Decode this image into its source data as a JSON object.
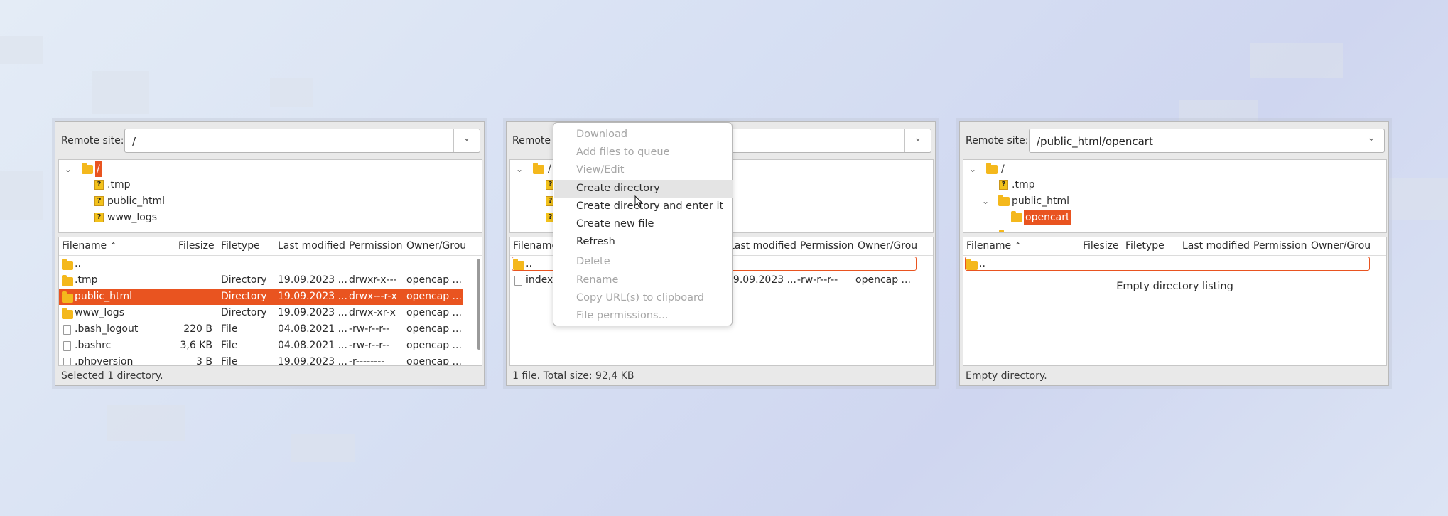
{
  "panel1": {
    "site_label": "Remote site:",
    "path": "/",
    "tree": [
      {
        "label": "/",
        "icon": "folder-icon"
      },
      {
        "label": ".tmp",
        "icon": "unknown-folder-icon"
      },
      {
        "label": "public_html",
        "icon": "unknown-folder-icon"
      },
      {
        "label": "www_logs",
        "icon": "unknown-folder-icon"
      }
    ],
    "columns": [
      "Filename",
      "Filesize",
      "Filetype",
      "Last modified",
      "Permission",
      "Owner/Grou"
    ],
    "rows": [
      {
        "name": "..",
        "size": "",
        "type": "",
        "modified": "",
        "perm": "",
        "owner": "",
        "kind": "folder"
      },
      {
        "name": ".tmp",
        "size": "",
        "type": "Directory",
        "modified": "19.09.2023 ...",
        "perm": "drwxr-x---",
        "owner": "opencap ...",
        "kind": "folder"
      },
      {
        "name": "public_html",
        "size": "",
        "type": "Directory",
        "modified": "19.09.2023 ...",
        "perm": "drwx---r-x",
        "owner": "opencap ...",
        "kind": "folder"
      },
      {
        "name": "www_logs",
        "size": "",
        "type": "Directory",
        "modified": "19.09.2023 ...",
        "perm": "drwx-xr-x",
        "owner": "opencap ...",
        "kind": "folder"
      },
      {
        "name": ".bash_logout",
        "size": "220 B",
        "type": "File",
        "modified": "04.08.2021 ...",
        "perm": "-rw-r--r--",
        "owner": "opencap ...",
        "kind": "file"
      },
      {
        "name": ".bashrc",
        "size": "3,6 KB",
        "type": "File",
        "modified": "04.08.2021 ...",
        "perm": "-rw-r--r--",
        "owner": "opencap ...",
        "kind": "file"
      },
      {
        "name": ".phpversion",
        "size": "3 B",
        "type": "File",
        "modified": "19.09.2023 ...",
        "perm": "-r--------",
        "owner": "opencap ...",
        "kind": "file"
      }
    ],
    "status": "Selected 1 directory."
  },
  "panel2": {
    "site_label": "Remote s",
    "tree": [
      {
        "label": "/",
        "icon": "folder-icon"
      }
    ],
    "columns": [
      "Filename",
      "Last modified",
      "Permission",
      "Owner/Grou"
    ],
    "rows": [
      {
        "name": "..",
        "modified": "",
        "perm": "",
        "owner": "",
        "kind": "folder"
      },
      {
        "name": "index.l",
        "modified": "19.09.2023 ...",
        "perm": "-rw-r--r--",
        "owner": "opencap ...",
        "kind": "file"
      }
    ],
    "status": "1 file. Total size: 92,4 KB"
  },
  "context_menu": {
    "items": [
      {
        "label": "Download",
        "enabled": false
      },
      {
        "label": "Add files to queue",
        "enabled": false
      },
      {
        "label": "View/Edit",
        "enabled": false
      },
      {
        "label": "Create directory",
        "enabled": true,
        "hover": true
      },
      {
        "label": "Create directory and enter it",
        "enabled": true
      },
      {
        "label": "Create new file",
        "enabled": true
      },
      {
        "label": "Refresh",
        "enabled": true
      },
      {
        "label": "Delete",
        "enabled": false
      },
      {
        "label": "Rename",
        "enabled": false
      },
      {
        "label": "Copy URL(s) to clipboard",
        "enabled": false
      },
      {
        "label": "File permissions...",
        "enabled": false
      }
    ]
  },
  "panel3": {
    "site_label": "Remote site:",
    "path": "/public_html/opencart",
    "tree": [
      {
        "label": "/",
        "icon": "folder-icon"
      },
      {
        "label": ".tmp",
        "icon": "unknown-folder-icon"
      },
      {
        "label": "public_html",
        "icon": "folder-icon"
      },
      {
        "label": "opencart",
        "icon": "folder-icon"
      }
    ],
    "columns": [
      "Filename",
      "Filesize",
      "Filetype",
      "Last modified",
      "Permission",
      "Owner/Grou"
    ],
    "rows": [
      {
        "name": "..",
        "kind": "folder"
      }
    ],
    "empty_message": "Empty directory listing",
    "status": "Empty directory."
  },
  "colors": {
    "accent": "#e95420",
    "folder": "#f4b81c",
    "unknown_folder": "#f3c21b",
    "disabled_text": "#a6a6a6"
  }
}
